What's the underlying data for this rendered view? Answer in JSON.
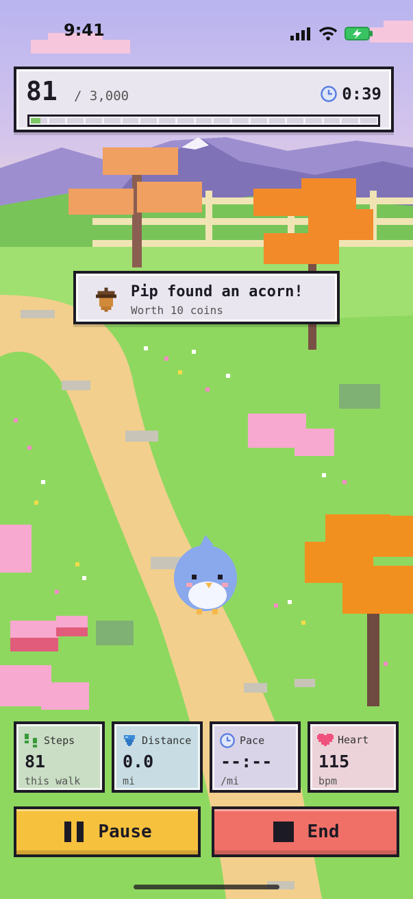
{
  "status": {
    "time": "9:41"
  },
  "progress": {
    "steps": "81",
    "goal": "/ 3,000",
    "timer": "0:39",
    "fraction": 0.027
  },
  "toast": {
    "title": "Pip found an acorn!",
    "subtitle": "Worth 10 coins",
    "icon": "acorn-icon"
  },
  "stats": [
    {
      "label": "Steps",
      "value": "81",
      "unit": "this walk",
      "icon": "footprints-icon",
      "color": "#c9dec4"
    },
    {
      "label": "Distance",
      "value": "0.0",
      "unit": "mi",
      "icon": "gem-icon",
      "color": "#c7dde3"
    },
    {
      "label": "Pace",
      "value": "--:--",
      "unit": "/mi",
      "icon": "clock-icon",
      "color": "#d9d4e8"
    },
    {
      "label": "Heart",
      "value": "115",
      "unit": "bpm",
      "icon": "heart-icon",
      "color": "#ecd3da"
    }
  ],
  "actions": {
    "pause": {
      "label": "Pause",
      "color": "#f6c13d",
      "icon": "pause-icon"
    },
    "end": {
      "label": "End",
      "color": "#f07068",
      "icon": "stop-icon"
    }
  },
  "colors": {
    "panel": "#e9e6ef",
    "outline": "#1c1a24",
    "accent_blue": "#3d8bd8"
  }
}
